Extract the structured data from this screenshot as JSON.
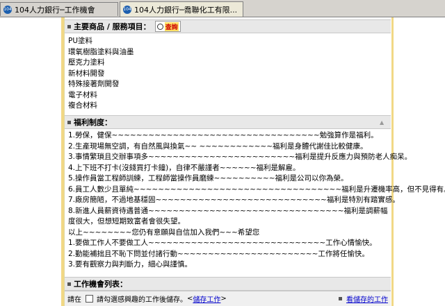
{
  "tabs": [
    {
      "label": "104人力銀行─工作機會",
      "icon": "104-favicon"
    },
    {
      "label": "104人力銀行─喬聯化工有限..."
    }
  ],
  "products": {
    "heading": "主要商品 / 服務項目：",
    "search_badge": "查詢",
    "items": [
      "PU塗料",
      "環氧樹脂塗料與油墨",
      "壓克力塗料",
      "新材料開發",
      "特殊接著劑開發",
      "電子材料",
      "複合材料"
    ]
  },
  "welfare": {
    "heading": "福利制度：",
    "lines": [
      "1.勞保，健保~~~~~~~~~~~~~~~~~~~~~~~~~~~~~~~~~~勉強算作是福利。",
      "2.生產現場無空調，有自然風與換氣~~ ~~~~~~~~~~~~福利是身體代謝佳比較健康。",
      "3.事情繁瑣且交辦事項多~~~~~~~~~~~~~~~~~~~~~~~~福利是提升反應力與預防老人痴呆。",
      "4.上下班不打卡(沒錢買打卡鐘)，自律不嚴謹者~~~~~~福利是解雇。",
      "5.操作員當工程師訓練，工程師當操作員磨練~~~~~~~~~~福利是公司以你為榮。",
      "6.員工人數少且單純~~~~~~~~~~~~~~~~~~~~~~~~~~~~~~~~~~福利是升遷機率高，但不見得有。",
      "7.廠房簡陋，不過地基穩固~~~~~~~~~~~~~~~~~~~~~~~~~~~~福利是特別有踏實感。",
      "8.新進人員薪資待遇普通~~~~~~~~~~~~~~~~~~~~~~~~~~~~~~~~福利是調薪幅度很大，但想短期致富者會很失望。",
      "以上~~~~~~~~您仍有意願與自信加入我們~~~希望您",
      "1.要做工作人不要做工人~~~~~~~~~~~~~~~~~~~~~~~~~~~~~工作心情愉快。",
      "2.勤能補拙且不恥下問並付諸行動~~~~~~~~~~~~~~~~~~~~~~~工作將任愉快。",
      "3.要有觀察力與判斷力，細心與謹慎。"
    ]
  },
  "job_list": {
    "heading": "工作機會列表："
  },
  "footer": {
    "prefix": "請在",
    "checkbox_text": "請勾選感興趣的工作後儲存。",
    "save_link": "儲存工作",
    "angle_open": "<",
    "angle_close": ">",
    "saved_link": "看儲存的工作"
  }
}
